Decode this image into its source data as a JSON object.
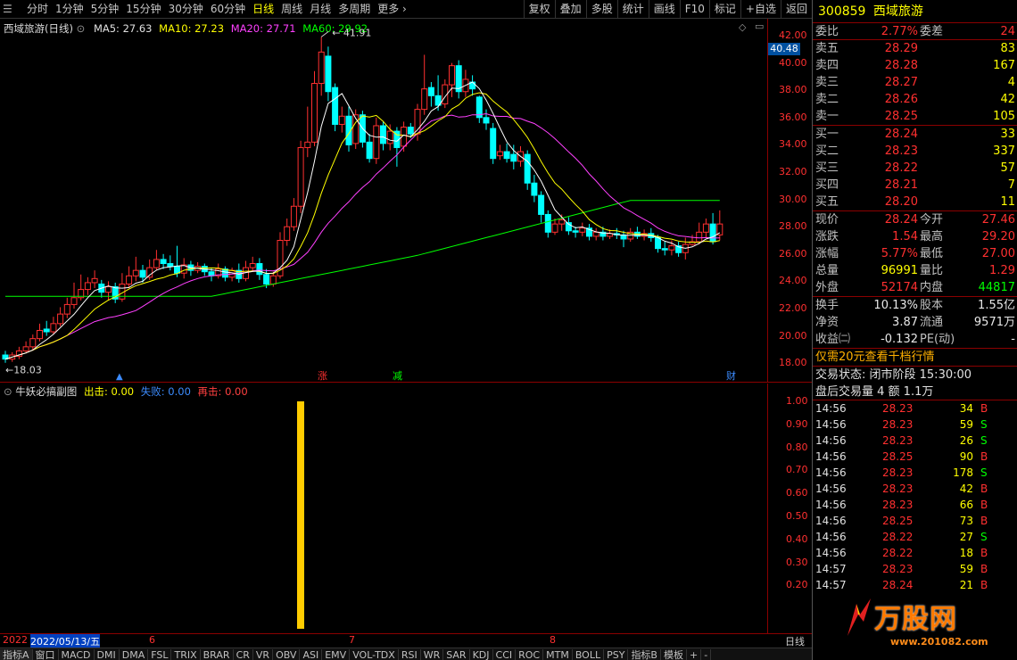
{
  "toolbar": {
    "left_items": [
      {
        "label": "分时",
        "active": false
      },
      {
        "label": "1分钟",
        "active": false
      },
      {
        "label": "5分钟",
        "active": false
      },
      {
        "label": "15分钟",
        "active": false
      },
      {
        "label": "30分钟",
        "active": false
      },
      {
        "label": "60分钟",
        "active": false
      },
      {
        "label": "日线",
        "active": true
      },
      {
        "label": "周线",
        "active": false
      },
      {
        "label": "月线",
        "active": false
      },
      {
        "label": "多周期",
        "active": false
      },
      {
        "label": "更多 ›",
        "active": false
      }
    ],
    "right_items": [
      "复权",
      "叠加",
      "多股",
      "统计",
      "画线",
      "F10",
      "标记",
      "+自选",
      "返回"
    ]
  },
  "main_chart": {
    "stock_title": "西域旅游(日线)",
    "ma5_label": "MA5: 27.63",
    "ma10_label": "MA10: 27.23",
    "ma20_label": "MA20: 27.71",
    "ma60_label": "MA60: 29.92",
    "price_labels": [
      "42.00",
      "40.00",
      "38.00",
      "36.00",
      "34.00",
      "32.00",
      "30.00",
      "28.00",
      "26.00",
      "24.00",
      "22.00",
      "20.00",
      "18.00"
    ],
    "current_price_box": "40.48",
    "high_marker": "41.91",
    "low_marker": "18.03",
    "markers": [
      "涨",
      "减",
      "财"
    ],
    "colors": {
      "up": "#ff3030",
      "down": "#00ffff",
      "ma5": "#ffffff",
      "ma10": "#ffff00",
      "ma20": "#ff40ff",
      "ma60": "#00ff00"
    }
  },
  "sub_chart": {
    "title": "牛妖必搞副图",
    "out_label": "出击: 0.00",
    "fail_label": "失败: 0.00",
    "again_label": "再击: 0.00",
    "axis_labels": [
      "1.00",
      "0.90",
      "0.80",
      "0.70",
      "0.60",
      "0.50",
      "0.40",
      "0.30",
      "0.20"
    ],
    "signal_value": 1.0
  },
  "date_axis": {
    "year": "2022",
    "selected_date": "2022/05/13/五",
    "months": [
      "6",
      "7",
      "8"
    ],
    "period": "日线"
  },
  "indicator_tabs": [
    "指标A",
    "窗口",
    "MACD",
    "DMI",
    "DMA",
    "FSL",
    "TRIX",
    "BRAR",
    "CR",
    "VR",
    "OBV",
    "ASI",
    "EMV",
    "VOL-TDX",
    "RSI",
    "WR",
    "SAR",
    "KDJ",
    "CCI",
    "ROC",
    "MTM",
    "BOLL",
    "PSY",
    "指标B",
    "模板",
    "+",
    "-"
  ],
  "panel": {
    "code": "300859",
    "name": "西域旅游",
    "weibi_label": "委比",
    "weibi": "2.77%",
    "weicha_label": "委差",
    "weicha": "24",
    "asks": [
      {
        "label": "卖五",
        "price": "28.29",
        "vol": "83"
      },
      {
        "label": "卖四",
        "price": "28.28",
        "vol": "167"
      },
      {
        "label": "卖三",
        "price": "28.27",
        "vol": "4"
      },
      {
        "label": "卖二",
        "price": "28.26",
        "vol": "42"
      },
      {
        "label": "卖一",
        "price": "28.25",
        "vol": "105"
      }
    ],
    "bids": [
      {
        "label": "买一",
        "price": "28.24",
        "vol": "33"
      },
      {
        "label": "买二",
        "price": "28.23",
        "vol": "337"
      },
      {
        "label": "买三",
        "price": "28.22",
        "vol": "57"
      },
      {
        "label": "买四",
        "price": "28.21",
        "vol": "7"
      },
      {
        "label": "买五",
        "price": "28.20",
        "vol": "11"
      }
    ],
    "quote": [
      {
        "l1": "现价",
        "v1": "28.24",
        "c1": "red",
        "l2": "今开",
        "v2": "27.46",
        "c2": "red"
      },
      {
        "l1": "涨跌",
        "v1": "1.54",
        "c1": "red",
        "l2": "最高",
        "v2": "29.20",
        "c2": "red"
      },
      {
        "l1": "涨幅",
        "v1": "5.77%",
        "c1": "red",
        "l2": "最低",
        "v2": "27.00",
        "c2": "red"
      },
      {
        "l1": "总量",
        "v1": "96991",
        "c1": "yellow",
        "l2": "量比",
        "v2": "1.29",
        "c2": "red"
      },
      {
        "l1": "外盘",
        "v1": "52174",
        "c1": "red",
        "l2": "内盘",
        "v2": "44817",
        "c2": "green"
      }
    ],
    "fundamentals": [
      {
        "l1": "换手",
        "v1": "10.13%",
        "l2": "股本",
        "v2": "1.55亿"
      },
      {
        "l1": "净资",
        "v1": "3.87",
        "l2": "流通",
        "v2": "9571万"
      },
      {
        "l1": "收益㈡",
        "v1": "-0.132",
        "l2": "PE(动)",
        "v2": "-"
      }
    ],
    "promo": "仅需20元查看千档行情",
    "trade_status": "交易状态: 闭市阶段 15:30:00",
    "after_volume": "盘后交易量 4 额 1.1万",
    "ticks": [
      {
        "time": "14:56",
        "price": "28.23",
        "qty": "34",
        "bs": "B",
        "color": "red"
      },
      {
        "time": "14:56",
        "price": "28.23",
        "qty": "59",
        "bs": "S",
        "color": "green"
      },
      {
        "time": "14:56",
        "price": "28.23",
        "qty": "26",
        "bs": "S",
        "color": "green"
      },
      {
        "time": "14:56",
        "price": "28.25",
        "qty": "90",
        "bs": "B",
        "color": "red"
      },
      {
        "time": "14:56",
        "price": "28.23",
        "qty": "178",
        "bs": "S",
        "color": "green"
      },
      {
        "time": "14:56",
        "price": "28.23",
        "qty": "42",
        "bs": "B",
        "color": "red"
      },
      {
        "time": "14:56",
        "price": "28.23",
        "qty": "66",
        "bs": "B",
        "color": "red"
      },
      {
        "time": "14:56",
        "price": "28.25",
        "qty": "73",
        "bs": "B",
        "color": "red"
      },
      {
        "time": "14:56",
        "price": "28.22",
        "qty": "27",
        "bs": "S",
        "color": "green"
      },
      {
        "time": "14:56",
        "price": "28.22",
        "qty": "18",
        "bs": "B",
        "color": "red"
      },
      {
        "time": "14:57",
        "price": "28.23",
        "qty": "59",
        "bs": "B",
        "color": "red"
      },
      {
        "time": "14:57",
        "price": "28.24",
        "qty": "21",
        "bs": "B",
        "color": "red"
      }
    ],
    "watermark_text": "万股网",
    "watermark_url": "www.201082.com"
  }
}
